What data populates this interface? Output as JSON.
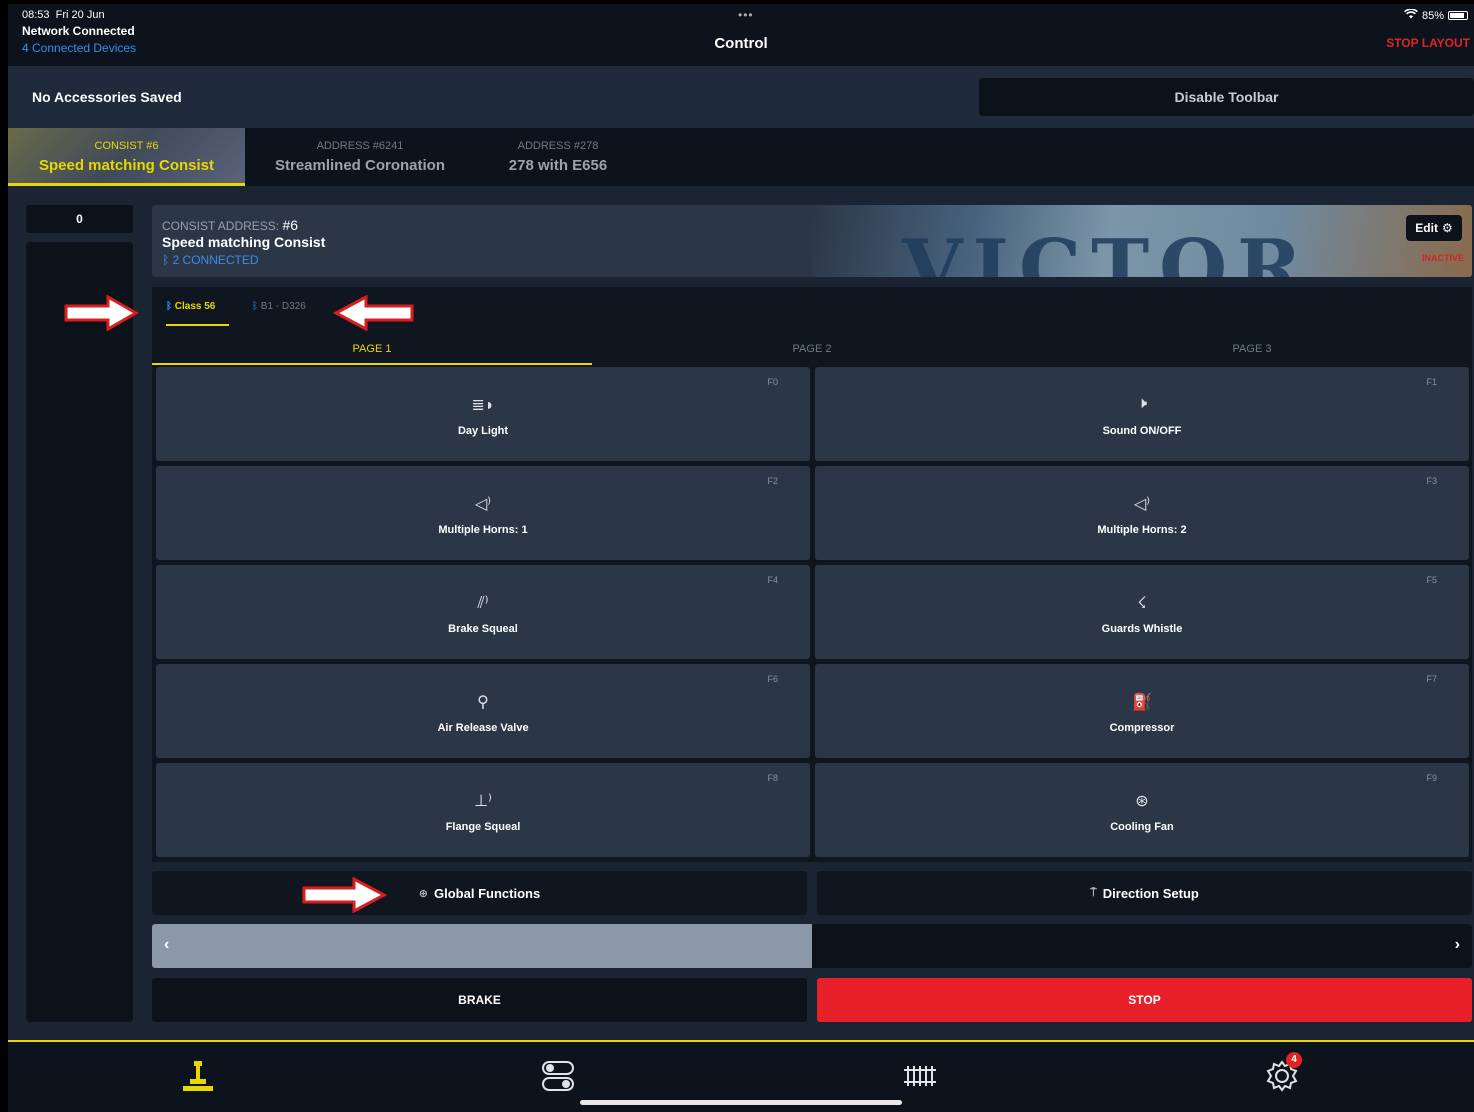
{
  "status": {
    "time": "08:53",
    "date": "Fri 20 Jun",
    "network": "Network Connected",
    "devices": "4 Connected Devices",
    "battery": "85%"
  },
  "header": {
    "title": "Control",
    "stop_layout": "STOP LAYOUT"
  },
  "accessories": {
    "empty_text": "No Accessories Saved",
    "disable_toolbar": "Disable Toolbar"
  },
  "loco_tabs": [
    {
      "small": "CONSIST #6",
      "big": "Speed matching Consist"
    },
    {
      "small": "ADDRESS #6241",
      "big": "Streamlined Coronation"
    },
    {
      "small": "ADDRESS #278",
      "big": "278 with E656"
    }
  ],
  "speed": {
    "value": "0",
    "slider_fraction": 0.5
  },
  "consist": {
    "address_label": "CONSIST ADDRESS:",
    "address_value": "#6",
    "name": "Speed matching Consist",
    "connected": "2 CONNECTED",
    "edit": "Edit",
    "inactive": "INACTIVE",
    "plate_text": "VICTOR"
  },
  "sub_tabs": [
    {
      "label": "Class 56"
    },
    {
      "label": "B1 - D326"
    }
  ],
  "page_tabs": [
    "PAGE 1",
    "PAGE 2",
    "PAGE 3"
  ],
  "functions": [
    {
      "num": "F0",
      "label": "Day Light",
      "icon": "headlight-icon"
    },
    {
      "num": "F1",
      "label": "Sound ON/OFF",
      "icon": "speaker-icon"
    },
    {
      "num": "F2",
      "label": "Multiple Horns: 1",
      "icon": "horn-icon"
    },
    {
      "num": "F3",
      "label": "Multiple Horns: 2",
      "icon": "horn-icon"
    },
    {
      "num": "F4",
      "label": "Brake Squeal",
      "icon": "brake-icon"
    },
    {
      "num": "F5",
      "label": "Guards Whistle",
      "icon": "whistle-icon"
    },
    {
      "num": "F6",
      "label": "Air Release Valve",
      "icon": "valve-icon"
    },
    {
      "num": "F7",
      "label": "Compressor",
      "icon": "compressor-icon"
    },
    {
      "num": "F8",
      "label": "Flange Squeal",
      "icon": "flange-icon"
    },
    {
      "num": "F9",
      "label": "Cooling Fan",
      "icon": "fan-icon"
    }
  ],
  "actions": {
    "global_functions": "Global Functions",
    "direction_setup": "Direction Setup",
    "brake": "BRAKE",
    "stop": "STOP"
  },
  "tabbar": {
    "items": [
      "throttle-icon",
      "toggles-icon",
      "track-icon",
      "settings-icon"
    ],
    "settings_badge": "4"
  },
  "colors": {
    "accent": "#e8d800",
    "stop": "#e8202a",
    "link": "#3a8de6"
  }
}
